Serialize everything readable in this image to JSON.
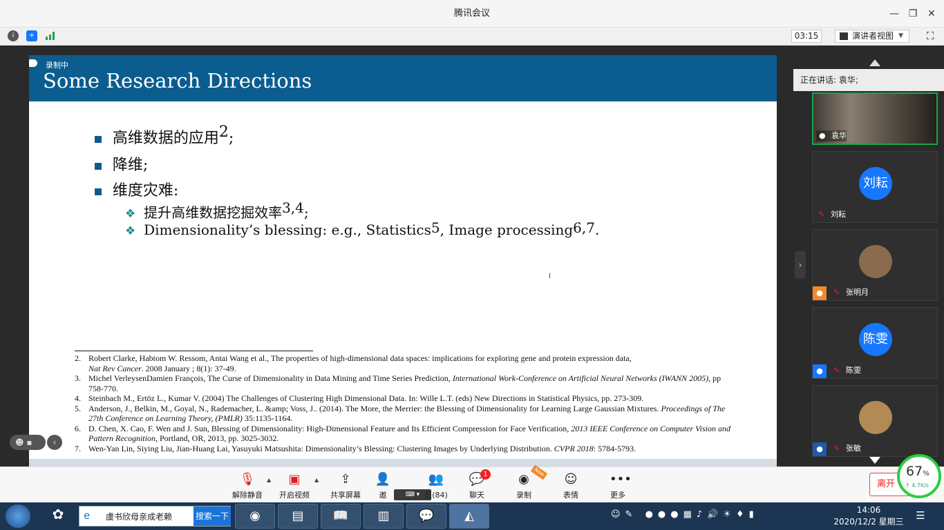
{
  "window": {
    "title": "腾讯会议"
  },
  "toolbar": {
    "timer": "03:15",
    "view_mode": "演讲者视图"
  },
  "recording": {
    "label": "录制中"
  },
  "slide": {
    "title": "Some Research Directions",
    "bullets": [
      {
        "text": "高维数据的应用",
        "sup": "2",
        "tail": ";"
      },
      {
        "text": "降维;",
        "sup": "",
        "tail": ""
      },
      {
        "text": "维度灾难:",
        "sup": "",
        "tail": ""
      }
    ],
    "subbullets": [
      {
        "text": "提升高维数据挖掘效率",
        "sup": "3,4",
        "tail": ";"
      },
      {
        "pre": "Dimensionality’s blessing: e.g., Statistics",
        "sup1": "5",
        "mid": ", Image processing",
        "sup2": "6,7",
        "tail": "."
      }
    ],
    "references": [
      {
        "n": "2.",
        "text": "Robert Clarke, Habtom W. Ressom, Antai Wang et al., The properties of high-dimensional data spaces: implications for exploring gene and protein expression data,",
        "text2_italic": "Nat Rev Cancer",
        "text2": ". 2008 January ; 8(1): 37-49."
      },
      {
        "n": "3.",
        "text": "Michel VerleysenDamien François, The Curse of Dimensionality in Data Mining and Time Series Prediction,",
        "italic": " International Work-Conference on Artificial Neural Networks (IWANN 2005)",
        "text2": ", pp 758-770."
      },
      {
        "n": "4.",
        "text": "Steinbach M., Ertöz L., Kumar V. (2004) The Challenges of Clustering High Dimensional Data. In: Wille L.T. (eds) New Directions in Statistical Physics, pp. 273-309."
      },
      {
        "n": "5.",
        "text": "Anderson, J., Belkin, M., Goyal, N., Rademacher, L. &amp; Voss, J.. (2014). The More, the Merrier: the Blessing of Dimensionality for Learning Large Gaussian Mixtures.",
        "italic": " Proceedings of The 27th Conference on Learning Theory, (PMLR)",
        "text2": " 35:1135-1164."
      },
      {
        "n": "6.",
        "text": "D. Chen, X. Cao, F. Wen and J. Sun, Blessing of Dimensionality: High-Dimensional Feature and Its Efficient Compression for Face Verification,",
        "italic": " 2013 IEEE Conference on Computer Vision and Pattern Recognition",
        "text2": ", Portland, OR, 2013, pp. 3025-3032."
      },
      {
        "n": "7.",
        "text": "Wen-Yan Lin, Siying Liu, Jian-Huang Lai, Yasuyuki Matsushita: Dimensionality’s Blessing: Clustering Images by Underlying Distribution.",
        "italic": " CVPR 2018",
        "text2": ": 5784-5793."
      }
    ]
  },
  "panel": {
    "speaking": "正在讲话: 袁华;",
    "participants": [
      {
        "name": "袁华",
        "initial": "",
        "video": true
      },
      {
        "name": "刘耘",
        "initial": "刘耘"
      },
      {
        "name": "张明月",
        "initial": ""
      },
      {
        "name": "陈雯",
        "initial": "陈雯"
      },
      {
        "name": "张敏",
        "initial": ""
      }
    ]
  },
  "bottombar": {
    "unmute": "解除静音",
    "video": "开启视频",
    "share": "共享屏幕",
    "invite": "邀",
    "members": "员(84)",
    "chat": "聊天",
    "chat_badge": "1",
    "record": "录制",
    "record_badge": "New",
    "emoji": "表情",
    "more": "更多",
    "leave": "离开",
    "network_percent": "67",
    "network_unit": "%",
    "network_speed": "↑ 4.7K/s"
  },
  "taskbar": {
    "search_text": "虞书欣母亲成老赖",
    "search_button": "搜索一下",
    "time": "14:06",
    "date": "2020/12/2 星期三"
  }
}
